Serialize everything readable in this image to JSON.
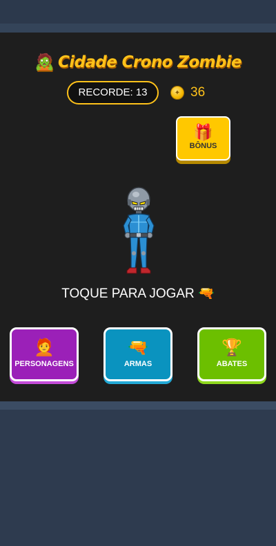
{
  "title": {
    "emoji": "🧟",
    "text": "Cidade Crono Zombie"
  },
  "stats": {
    "record_label": "RECORDE: 13",
    "coins_icon": "coin-icon",
    "coins": "36"
  },
  "bonus": {
    "icon": "🎁",
    "label": "BÔNUS"
  },
  "prompt": {
    "text": "TOQUE PARA JOGAR 🔫"
  },
  "menu": [
    {
      "icon": "🧑‍🦰",
      "label": "PERSONAGENS",
      "color": "#9b20b8"
    },
    {
      "icon": "🔫",
      "label": "ARMAS",
      "color": "#0a93bf"
    },
    {
      "icon": "🏆",
      "label": "ABATES",
      "color": "#6cbf00"
    }
  ],
  "colors": {
    "accent": "#ffc21a",
    "panel_bg": "#1e1e1e",
    "page_bg": "#2e3b4f",
    "bonus_bg": "#ffc800"
  }
}
